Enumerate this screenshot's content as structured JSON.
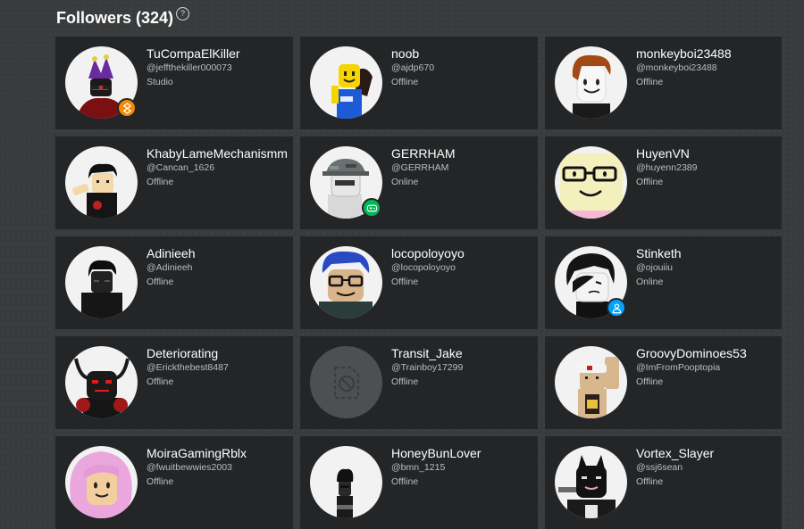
{
  "header": {
    "title": "Followers (324)",
    "help_glyph": "?"
  },
  "colors": {
    "studio_badge": "#f68802",
    "online_game_badge": "#02b757",
    "online_badge": "#00a2ff"
  },
  "followers": [
    {
      "display_name": "TuCompaElKiller",
      "username": "@jeffthekiller000073",
      "status": "Studio",
      "presence_icon": "studio-icon"
    },
    {
      "display_name": "noob",
      "username": "@ajdp670",
      "status": "Offline"
    },
    {
      "display_name": "monkeyboi23488",
      "username": "@monkeyboi23488",
      "status": "Offline"
    },
    {
      "display_name": "KhabyLameMechanismm",
      "username": "@Cancan_1626",
      "status": "Offline"
    },
    {
      "display_name": "GERRHAM",
      "username": "@GERRHAM",
      "status": "Online",
      "presence_icon": "game-controller-icon"
    },
    {
      "display_name": "HuyenVN",
      "username": "@huyenn2389",
      "status": "Offline"
    },
    {
      "display_name": "Adinieeh",
      "username": "@Adinieeh",
      "status": "Offline"
    },
    {
      "display_name": "locopoloyoyo",
      "username": "@locopoloyoyo",
      "status": "Offline"
    },
    {
      "display_name": "Stinketh",
      "username": "@ojouiiu",
      "status": "Online",
      "presence_icon": "person-icon"
    },
    {
      "display_name": "Deteriorating",
      "username": "@Erickthebest8487",
      "status": "Offline"
    },
    {
      "display_name": "Transit_Jake",
      "username": "@Trainboy17299",
      "status": "Offline",
      "avatar_unavailable": true
    },
    {
      "display_name": "GroovyDominoes53",
      "username": "@ImFromPooptopia",
      "status": "Offline"
    },
    {
      "display_name": "MoiraGamingRblx",
      "username": "@fwuitbewwies2003",
      "status": "Offline"
    },
    {
      "display_name": "HoneyBunLover",
      "username": "@bmn_1215",
      "status": "Offline"
    },
    {
      "display_name": "Vortex_Slayer",
      "username": "@ssj6sean",
      "status": "Offline"
    }
  ]
}
